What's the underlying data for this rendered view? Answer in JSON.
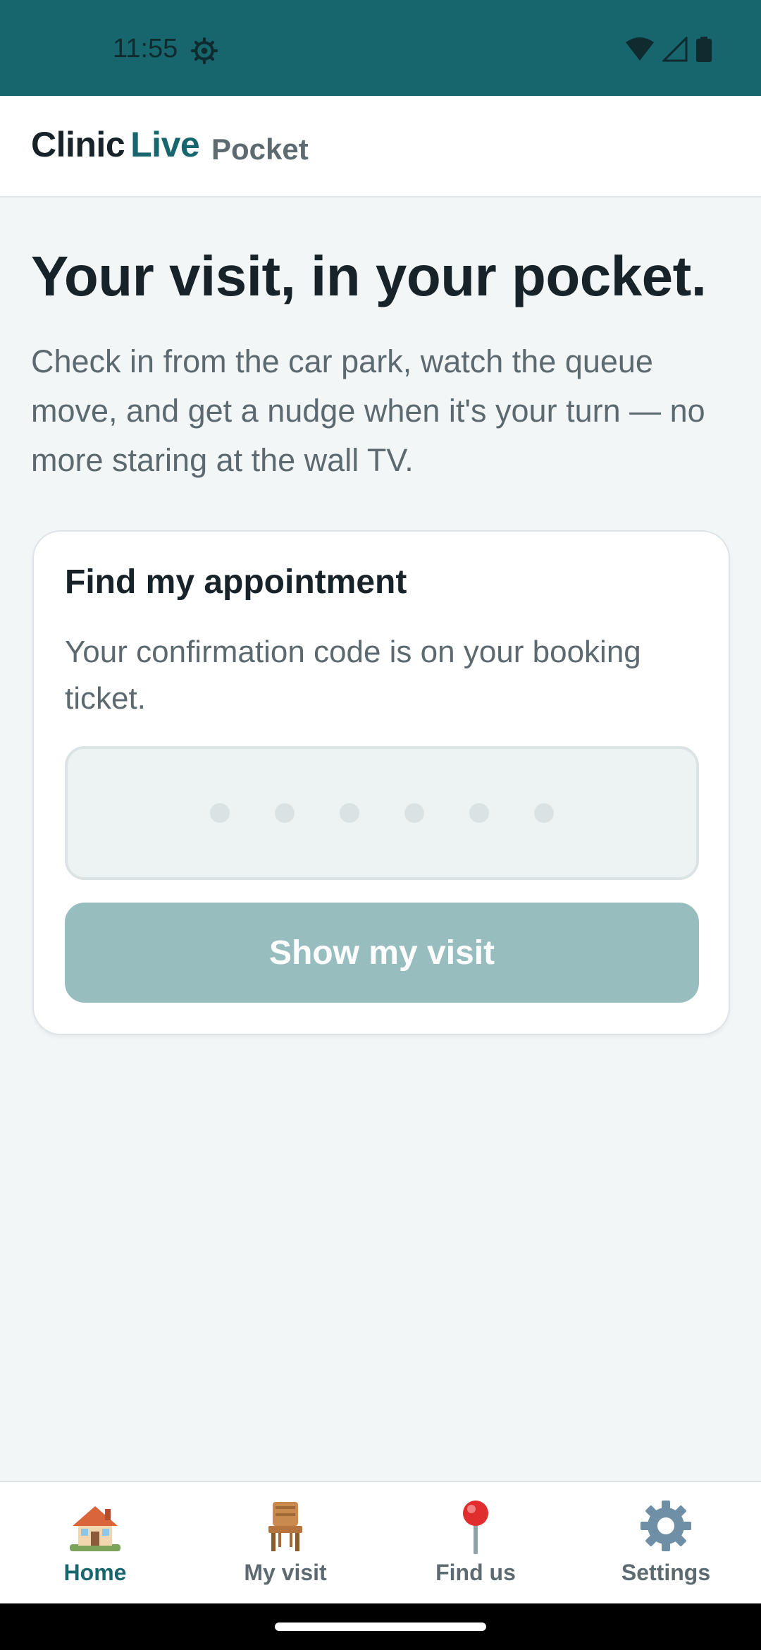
{
  "status_bar": {
    "time": "11:55"
  },
  "header": {
    "brand_first": "Clinic",
    "brand_second": "Live",
    "subtitle": "Pocket"
  },
  "hero": {
    "title": "Your visit, in your pocket.",
    "text": "Check in from the car park, watch the queue move, and get a nudge when it's your turn — no more staring at the wall TV."
  },
  "card": {
    "title": "Find my appointment",
    "text": "Your confirmation code is on your booking ticket.",
    "code_value": "",
    "code_length": 6,
    "button_label": "Show my visit"
  },
  "nav": {
    "active": "Home",
    "items": [
      {
        "label": "Home",
        "icon": "house-icon"
      },
      {
        "label": "My visit",
        "icon": "chair-icon"
      },
      {
        "label": "Find us",
        "icon": "map-pin-icon"
      },
      {
        "label": "Settings",
        "icon": "gear-icon"
      }
    ]
  },
  "colors": {
    "accent": "#17666d",
    "button_disabled": "#97bdbf",
    "background": "#f2f6f7"
  }
}
